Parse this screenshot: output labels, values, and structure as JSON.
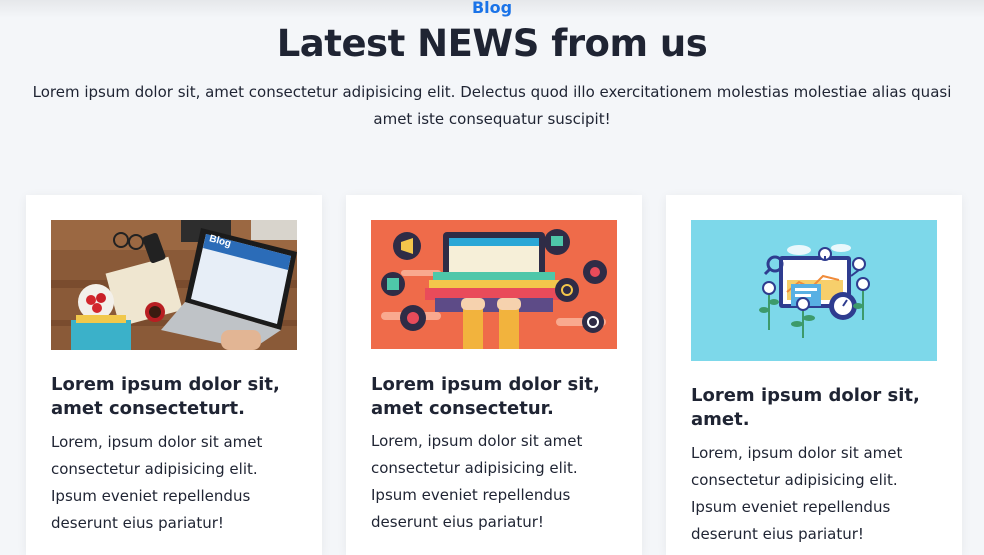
{
  "section": {
    "eyebrow": "Blog",
    "title": "Latest NEWS from us",
    "description": "Lorem ipsum dolor sit, amet consectetur adipisicing elit. Delectus quod illo exercitationem molestias molestiae alias quasi amet iste consequatur suscipit!"
  },
  "cards": [
    {
      "image_label": "Blog",
      "title": "Lorem ipsum dolor sit, amet consecteturt.",
      "body": "Lorem, ipsum dolor sit amet consectetur adipisicing elit. Ipsum eveniet repellendus deserunt eius pariatur!"
    },
    {
      "title": "Lorem ipsum dolor sit, amet consectetur.",
      "body": "Lorem, ipsum dolor sit amet consectetur adipisicing elit. Ipsum eveniet repellendus deserunt eius pariatur!"
    },
    {
      "title": "Lorem ipsum dolor sit, amet.",
      "body": "Lorem, ipsum dolor sit amet consectetur adipisicing elit. Ipsum eveniet repellendus deserunt eius pariatur!"
    }
  ],
  "colors": {
    "accent": "#1a73e8",
    "heading": "#1f2433",
    "page_background": "#f4f6f9",
    "card_background": "#ffffff"
  },
  "icons": [
    "laptop-desk-illustration",
    "laptop-media-icons-illustration",
    "analytics-dashboard-illustration"
  ]
}
